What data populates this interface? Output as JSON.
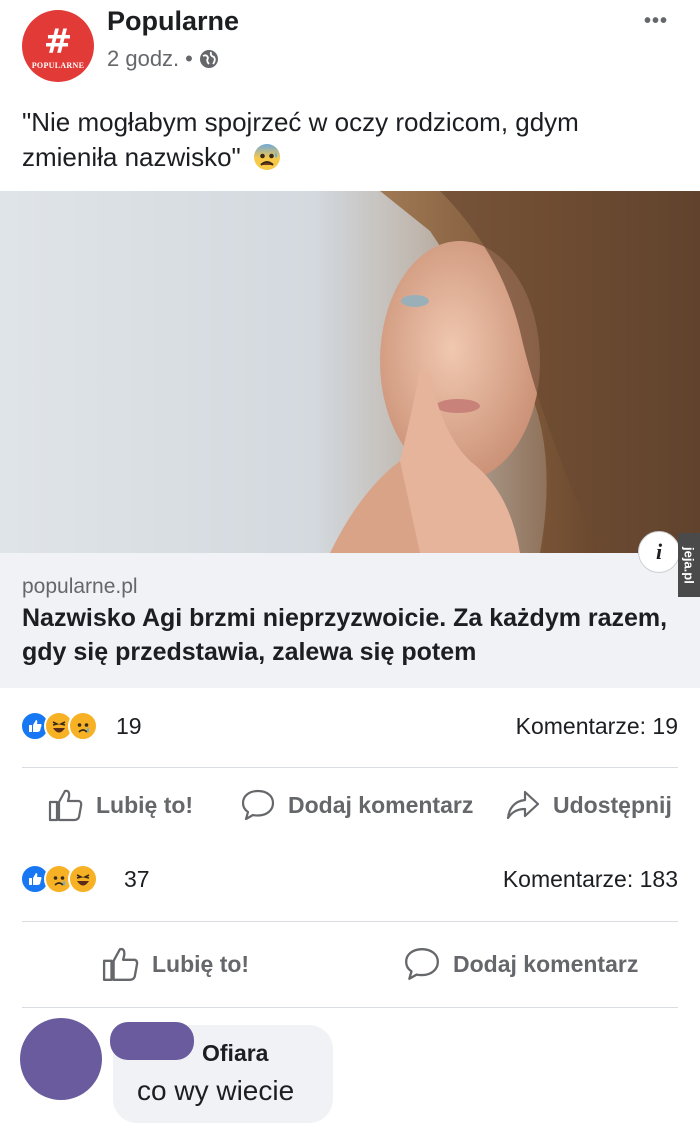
{
  "post": {
    "page_name": "Popularne",
    "avatar_symbol": "#",
    "avatar_brand": "POPULARNE",
    "time": "2 godz.",
    "separator": "•",
    "privacy_icon": "globe-icon",
    "more_icon": "more-icon",
    "text": "\"Nie mogłabym spojrzeć w oczy rodzicom, gdym zmieniła nazwisko\"",
    "text_emoji": "anxious-face-icon",
    "image_icon": "photo-woman"
  },
  "link_preview": {
    "domain": "popularne.pl",
    "title": "Nazwisko Agi brzmi nieprzyzwoicie. Za każdym razem, gdy się przedstawia, zalewa się potem",
    "info_label": "i",
    "watermark": "jeja.pl"
  },
  "top_post": {
    "reactions": [
      "like",
      "haha",
      "sad"
    ],
    "reaction_count": "19",
    "comments": "Komentarze: 19",
    "actions": {
      "like": "Lubię to!",
      "comment": "Dodaj komentarz",
      "share": "Udostępnij"
    }
  },
  "bottom_post": {
    "reactions": [
      "like",
      "sad",
      "haha"
    ],
    "reaction_count": "37",
    "comments": "Komentarze: 183",
    "actions": {
      "like": "Lubię to!",
      "comment": "Dodaj komentarz"
    }
  },
  "comment": {
    "author": "Ofiara",
    "text": "co wy wiecie"
  },
  "colors": {
    "brand_red": "#e23a37",
    "like_blue": "#1877f2",
    "emoji_yellow": "#f7b125",
    "redaction_purple": "#6a5b9e"
  }
}
